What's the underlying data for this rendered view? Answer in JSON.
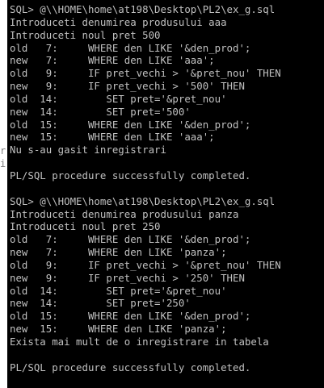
{
  "left_strip": {
    "glyphs": [
      "r",
      "i:"
    ]
  },
  "console": {
    "lines": [
      "SQL> @\\\\HOME\\home\\at198\\Desktop\\PL2\\ex_g.sql",
      "Introduceti denumirea produsului aaa",
      "Introduceti noul pret 500",
      "old   7:     WHERE den LIKE '&den_prod';",
      "new   7:     WHERE den LIKE 'aaa';",
      "old   9:     IF pret_vechi > '&pret_nou' THEN",
      "new   9:     IF pret_vechi > '500' THEN",
      "old  14:        SET pret='&pret_nou'",
      "new  14:        SET pret='500'",
      "old  15:     WHERE den LIKE '&den_prod';",
      "new  15:     WHERE den LIKE 'aaa';",
      "Nu s-au gasit inregistrari",
      "",
      "PL/SQL procedure successfully completed.",
      "",
      "SQL> @\\\\HOME\\home\\at198\\Desktop\\PL2\\ex_g.sql",
      "Introduceti denumirea produsului panza",
      "Introduceti noul pret 250",
      "old   7:     WHERE den LIKE '&den_prod';",
      "new   7:     WHERE den LIKE 'panza';",
      "old   9:     IF pret_vechi > '&pret_nou' THEN",
      "new   9:     IF pret_vechi > '250' THEN",
      "old  14:        SET pret='&pret_nou'",
      "new  14:        SET pret='250'",
      "old  15:     WHERE den LIKE '&den_prod';",
      "new  15:     WHERE den LIKE 'panza';",
      "Exista mai mult de o inregistrare in tabela",
      "",
      "PL/SQL procedure successfully completed."
    ]
  },
  "colors": {
    "console_background": "#000000",
    "console_text": "#c0c0c0"
  }
}
